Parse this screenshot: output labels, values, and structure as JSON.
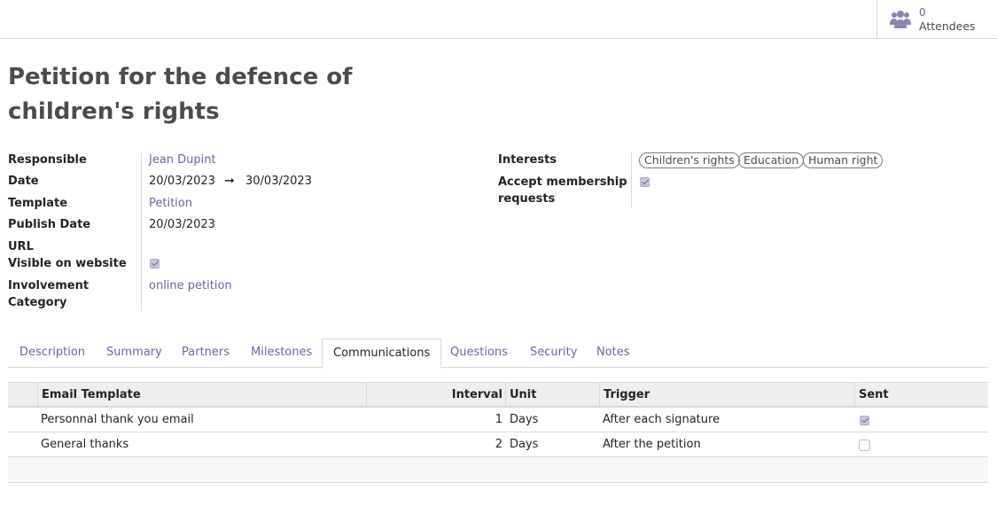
{
  "smart_button": {
    "count": "0",
    "label": "Attendees",
    "icon": "users-icon"
  },
  "record": {
    "title": "Petition for the defence of children's rights"
  },
  "fields_left": {
    "responsible": {
      "label": "Responsible",
      "value": "Jean Dupint"
    },
    "date": {
      "label": "Date",
      "start": "20/03/2023",
      "arrow": "➞",
      "end": "30/03/2023"
    },
    "template": {
      "label": "Template",
      "value": "Petition"
    },
    "publish_date": {
      "label": "Publish Date",
      "value": "20/03/2023"
    },
    "url": {
      "label": "URL",
      "value": ""
    },
    "visible_on_website": {
      "label": "Visible on website",
      "checked": true
    },
    "involvement_category": {
      "label_line1": "Involvement",
      "label_line2": "Category",
      "value": "online petition"
    }
  },
  "fields_right": {
    "interests": {
      "label": "Interests",
      "tags": [
        "Children's rights",
        "Education",
        "Human right"
      ]
    },
    "accept_membership": {
      "label_line1": "Accept membership",
      "label_line2": "requests",
      "checked": true
    }
  },
  "tabs": [
    "Description",
    "Summary",
    "Partners",
    "Milestones",
    "Communications",
    "Questions",
    "Security",
    "Notes"
  ],
  "active_tab": "Communications",
  "communications_table": {
    "columns": [
      "Email Template",
      "Interval",
      "Unit",
      "Trigger",
      "Sent"
    ],
    "rows": [
      {
        "email_template": "Personnal thank you email",
        "interval": "1",
        "unit": "Days",
        "trigger": "After each signature",
        "sent": true
      },
      {
        "email_template": "General thanks",
        "interval": "2",
        "unit": "Days",
        "trigger": "After the petition",
        "sent": false
      }
    ]
  },
  "colors": {
    "link": "#71639e",
    "title": "#4c4c4c",
    "border": "#d8d8d8",
    "header_bg": "#eeeeee"
  }
}
